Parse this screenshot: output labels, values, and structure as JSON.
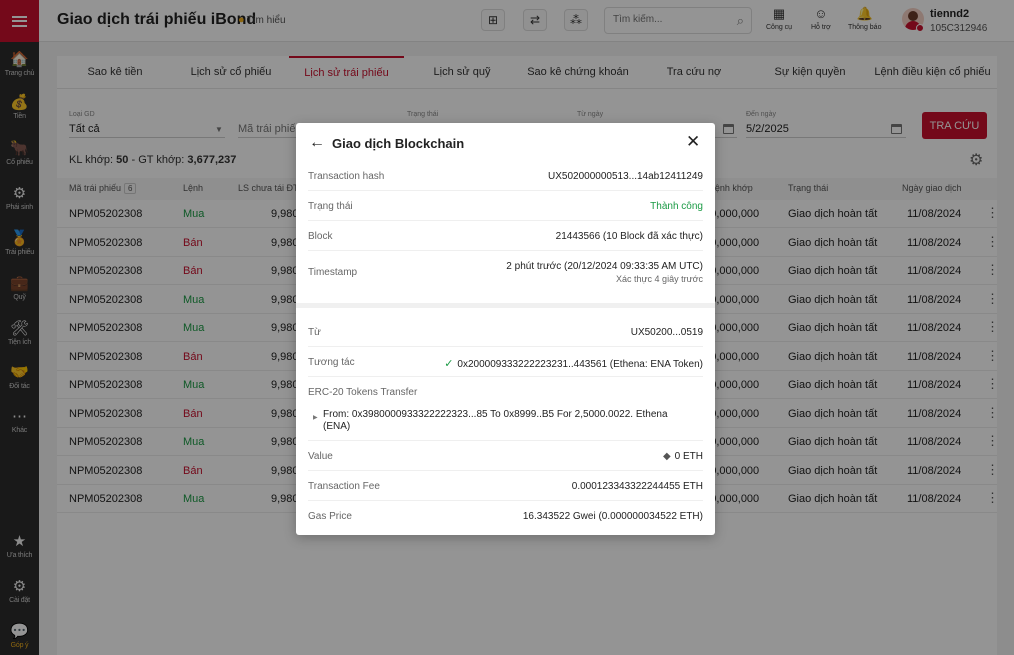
{
  "sidebar": {
    "items": [
      {
        "label": "Trang chủ",
        "icon": "home-icon",
        "glyph": "🏠"
      },
      {
        "label": "Tiền",
        "icon": "money-icon",
        "glyph": "💰"
      },
      {
        "label": "Cổ phiếu",
        "icon": "bull-icon",
        "glyph": "🐂"
      },
      {
        "label": "Phái sinh",
        "icon": "derivative-icon",
        "glyph": "⚙"
      },
      {
        "label": "Trái phiếu",
        "icon": "bond-icon",
        "glyph": "🏅"
      },
      {
        "label": "Quỹ",
        "icon": "fund-icon",
        "glyph": "💼"
      },
      {
        "label": "Tiện ích",
        "icon": "tools-icon",
        "glyph": "🛠"
      },
      {
        "label": "Đối tác",
        "icon": "partner-icon",
        "glyph": "🤝"
      },
      {
        "label": "Khác",
        "icon": "more-icon",
        "glyph": "⋯"
      }
    ],
    "bottom": [
      {
        "label": "Ưa thích",
        "icon": "star-icon",
        "glyph": "★"
      },
      {
        "label": "Cài đặt",
        "icon": "gear-icon",
        "glyph": "⚙"
      },
      {
        "label": "Góp ý",
        "icon": "feedback-icon",
        "glyph": "💬"
      }
    ]
  },
  "header": {
    "title": "Giao dịch trái phiếu iBond",
    "learn": "Tìm hiểu",
    "search_placeholder": "Tìm kiếm...",
    "tools": [
      {
        "label": "Công cụ",
        "icon": "calculator-icon",
        "glyph": "▦"
      },
      {
        "label": "Hỗ trợ",
        "icon": "support-icon",
        "glyph": "☺"
      },
      {
        "label": "Thông báo",
        "icon": "bell-icon",
        "glyph": "🔔"
      }
    ],
    "user": {
      "name": "tiennd2",
      "id": "105C312946"
    }
  },
  "tabs": [
    "Sao kê tiền",
    "Lịch sử cổ phiếu",
    "Lịch sử trái phiếu",
    "Lịch sử quỹ",
    "Sao kê chứng khoán",
    "Tra cứu nợ",
    "Sự kiện quyền",
    "Lệnh điều kiện cổ phiếu"
  ],
  "filters": {
    "type_label": "Loại GD",
    "type_value": "Tất cả",
    "code_placeholder": "Mã trái phiếu",
    "status_label": "Trạng thái",
    "from_label": "Từ ngày",
    "to_label": "Đến ngày",
    "to_value": "5/2/2025",
    "search_button": "TRA CỨU"
  },
  "summary": {
    "kl_label": "KL khớp:",
    "kl_value": "50",
    "gt_label": "GT khớp:",
    "gt_value": "3,677,237"
  },
  "table": {
    "headers": {
      "code": "Mã trái phiếu",
      "count": "6",
      "side": "Lệnh",
      "ls": "LS chưa tái ĐT",
      "gt": "GT lệnh khớp",
      "status": "Trạng thái",
      "date": "Ngày giao dịch"
    },
    "rows": [
      {
        "code": "NPM05202308",
        "side": "Mua",
        "ls": "9,980",
        "gt": "100,000,000",
        "status": "Giao dịch hoàn tất",
        "date": "11/08/2024"
      },
      {
        "code": "NPM05202308",
        "side": "Bán",
        "ls": "9,980",
        "gt": "100,000,000",
        "status": "Giao dịch hoàn tất",
        "date": "11/08/2024"
      },
      {
        "code": "NPM05202308",
        "side": "Bán",
        "ls": "9,980",
        "gt": "100,000,000",
        "status": "Giao dịch hoàn tất",
        "date": "11/08/2024"
      },
      {
        "code": "NPM05202308",
        "side": "Mua",
        "ls": "9,980",
        "gt": "100,000,000",
        "status": "Giao dịch hoàn tất",
        "date": "11/08/2024"
      },
      {
        "code": "NPM05202308",
        "side": "Mua",
        "ls": "9,980",
        "gt": "100,000,000",
        "status": "Giao dịch hoàn tất",
        "date": "11/08/2024"
      },
      {
        "code": "NPM05202308",
        "side": "Bán",
        "ls": "9,980",
        "gt": "100,000,000",
        "status": "Giao dịch hoàn tất",
        "date": "11/08/2024"
      },
      {
        "code": "NPM05202308",
        "side": "Mua",
        "ls": "9,980",
        "gt": "100,000,000",
        "status": "Giao dịch hoàn tất",
        "date": "11/08/2024"
      },
      {
        "code": "NPM05202308",
        "side": "Bán",
        "ls": "9,980",
        "gt": "100,000,000",
        "status": "Giao dịch hoàn tất",
        "date": "11/08/2024"
      },
      {
        "code": "NPM05202308",
        "side": "Mua",
        "ls": "9,980",
        "gt": "100,000,000",
        "status": "Giao dịch hoàn tất",
        "date": "11/08/2024"
      },
      {
        "code": "NPM05202308",
        "side": "Bán",
        "ls": "9,980",
        "gt": "100,000,000",
        "status": "Giao dịch hoàn tất",
        "date": "11/08/2024"
      },
      {
        "code": "NPM05202308",
        "side": "Mua",
        "ls": "9,980",
        "gt": "100,000,000",
        "status": "Giao dịch hoàn tất",
        "date": "11/08/2024"
      }
    ]
  },
  "modal": {
    "title": "Giao dịch Blockchain",
    "hash_label": "Transaction hash",
    "hash_value": "UX502000000513...14ab12411249",
    "status_label": "Trạng thái",
    "status_value": "Thành công",
    "block_label": "Block",
    "block_value": "21443566 (10 Block đã xác thực)",
    "timestamp_label": "Timestamp",
    "timestamp_value": "2 phút trước (20/12/2024 09:33:35 AM UTC)",
    "timestamp_sub": "Xác thực 4 giây trước",
    "from_label": "Từ",
    "from_value": "UX50200...0519",
    "interact_label": "Tương tác",
    "interact_value": "0x200009333222223231..443561 (Ethena: ENA Token)",
    "erc_label": "ERC-20 Tokens Transfer",
    "erc_line1": "From: 0x3980000933322222323...85 To 0x8999..B5 For 2,5000.0022. Ethena",
    "erc_line2": "(ENA)",
    "value_label": "Value",
    "value_value": "0 ETH",
    "fee_label": "Transaction Fee",
    "fee_value": "0.000123343322244455 ETH",
    "gas_label": "Gas Price",
    "gas_value": "16.343522 Gwei (0.000000034522 ETH)"
  },
  "colors": {
    "brand": "#c8102e",
    "success": "#1a9a44",
    "sidebar": "#2b2b2b"
  }
}
